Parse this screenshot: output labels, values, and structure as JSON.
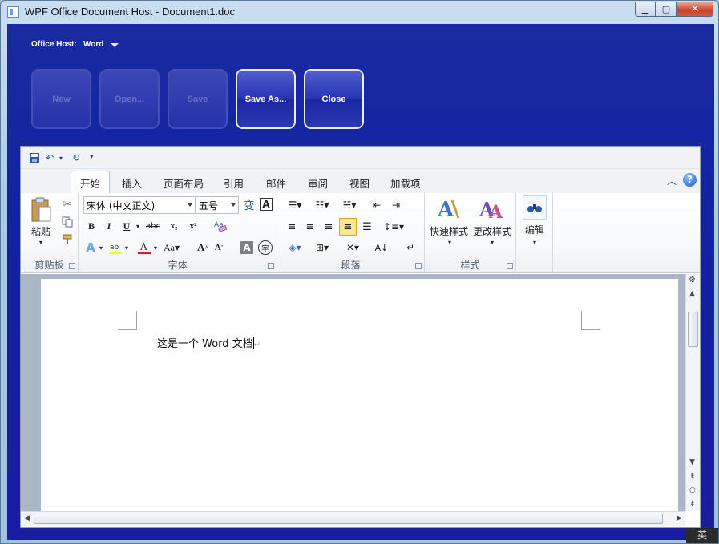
{
  "window": {
    "title": "WPF Office Document Host - Document1.doc"
  },
  "host": {
    "label": "Office Host:",
    "value": "Word",
    "buttons": [
      {
        "label": "New",
        "enabled": false
      },
      {
        "label": "Open...",
        "enabled": false
      },
      {
        "label": "Save",
        "enabled": false
      },
      {
        "label": "Save As...",
        "enabled": true
      },
      {
        "label": "Close",
        "enabled": true
      }
    ]
  },
  "office": {
    "tabs": [
      "开始",
      "插入",
      "页面布局",
      "引用",
      "邮件",
      "审阅",
      "视图",
      "加载项"
    ],
    "active_tab": "开始",
    "groups": {
      "clipboard": {
        "label": "剪贴板",
        "paste": "粘贴"
      },
      "font": {
        "label": "字体",
        "font_name": "宋体 (中文正文)",
        "font_size": "五号"
      },
      "paragraph": {
        "label": "段落"
      },
      "styles": {
        "label": "样式",
        "quick_styles": "快速样式",
        "change_styles": "更改样式"
      },
      "editing": {
        "label": "编辑"
      }
    },
    "document_text": "这是一个 Word 文档"
  },
  "status": {
    "ime": "英"
  },
  "colors": {
    "host_blue": "#1221a5",
    "accent": "#2b58a8"
  }
}
